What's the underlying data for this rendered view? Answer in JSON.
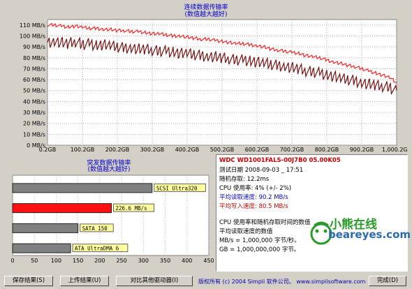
{
  "colors": {
    "read_series": "#7a1010",
    "write_series": "#ff2020",
    "bar_default": "#808080",
    "bar_highlight": "#ff1010",
    "title_blue": "#0000cc",
    "info_red": "#cc0000",
    "label_bg": "#ffffa0"
  },
  "top_chart": {
    "title": "连续数据传输率",
    "subtitle": "(数值越大越好)"
  },
  "burst_chart": {
    "title": "突发数据传输率",
    "subtitle": "(数值越大越好)"
  },
  "chart_data": [
    {
      "type": "line",
      "title": "连续数据传输率",
      "subtitle": "(数值越大越好)",
      "x_ticks": [
        "0.2GB",
        "100.2GB",
        "200.2GB",
        "300.2GB",
        "400.2GB",
        "500.2GB",
        "600.2GB",
        "700.2GB",
        "800.2GB",
        "900.2GB",
        "1,000.2GB"
      ],
      "y_ticks": [
        "0 MB/s",
        "10 MB/s",
        "20 MB/s",
        "30 MB/s",
        "40 MB/s",
        "50 MB/s",
        "60 MB/s",
        "70 MB/s",
        "80 MB/s",
        "90 MB/s",
        "100 MB/s",
        "110 MB/s"
      ],
      "xlim": [
        0.2,
        1000.2
      ],
      "ylim": [
        0,
        115
      ],
      "grid": true,
      "series": [
        {
          "x": [
            0.2,
            20,
            40,
            60,
            80,
            100,
            120,
            140,
            160,
            180,
            200,
            220,
            240,
            260,
            280,
            300,
            320,
            340,
            360,
            380,
            400,
            420,
            440,
            460,
            480,
            500,
            520,
            540,
            560,
            580,
            600,
            620,
            640,
            660,
            680,
            700,
            720,
            740,
            760,
            780,
            800,
            820,
            840,
            860,
            880,
            900,
            920,
            940,
            960,
            980,
            1000.2
          ],
          "y": [
            110,
            110,
            109,
            108,
            109,
            108,
            107,
            107,
            106,
            106,
            105,
            105,
            104,
            104,
            103,
            102,
            102,
            101,
            100,
            100,
            99,
            98,
            97,
            97,
            96,
            95,
            94,
            93,
            93,
            92,
            91,
            90,
            88,
            87,
            86,
            85,
            84,
            82,
            81,
            80,
            78,
            76,
            75,
            73,
            72,
            70,
            68,
            66,
            64,
            62,
            57
          ]
        },
        {
          "x": [
            0.2,
            20,
            40,
            60,
            80,
            100,
            120,
            140,
            160,
            180,
            200,
            220,
            240,
            260,
            280,
            300,
            320,
            340,
            360,
            380,
            400,
            420,
            440,
            460,
            480,
            500,
            520,
            540,
            560,
            580,
            600,
            620,
            640,
            660,
            680,
            700,
            720,
            740,
            760,
            780,
            800,
            820,
            840,
            860,
            880,
            900,
            920,
            940,
            960,
            980,
            1000.2
          ],
          "y": [
            95,
            96,
            95,
            94,
            96,
            93,
            94,
            92,
            93,
            92,
            91,
            90,
            90,
            89,
            89,
            88,
            87,
            87,
            86,
            85,
            85,
            84,
            83,
            82,
            82,
            81,
            80,
            79,
            79,
            78,
            77,
            76,
            75,
            74,
            73,
            72,
            71,
            69,
            68,
            67,
            65,
            64,
            62,
            61,
            60,
            58,
            57,
            56,
            55,
            54,
            50
          ]
        }
      ]
    },
    {
      "type": "bar",
      "title": "突发数据传输率",
      "subtitle": "(数值越大越好)",
      "orientation": "horizontal",
      "categories": [
        "SCSI Ultra320",
        "226.6 MB/s",
        "SATA 150",
        "ATA UltraDMA 6"
      ],
      "values": [
        320,
        226.6,
        150,
        133
      ],
      "x_ticks": [
        "0",
        "50",
        "100",
        "150",
        "200",
        "250",
        "300",
        "350",
        "400",
        "450"
      ],
      "xlim": [
        0,
        450
      ],
      "highlight_index": 1
    }
  ],
  "info": {
    "drive_name": "WDC WD1001FALS-00J7B0 05.00K05",
    "test_date": "测试日期 2008-09-03 _ 17:51",
    "random_access": "随机存取: 12.2ms",
    "cpu_usage": "CPU 使用率: 4% (+/- 2%)",
    "avg_read": "平均读取速度: 90.2 MB/s",
    "avg_write": "平均写入速度: 80.5 MB/s",
    "note_1": "CPU 使用率和随机存取时间的数值",
    "note_2": "平均读取速度的数值",
    "note_3": "MB/s = 1,000,000 字节/秒。",
    "note_4": "GB = 1,000,000,000 字节。",
    "logo_cn": "小熊在线",
    "logo_en": "beareyes.com"
  },
  "buttons": {
    "save": "保存结果(S)",
    "upload": "上传结果(U)",
    "compare": "对比其他驱动器(I)",
    "done": "完成(D)"
  },
  "copyright": "版权所有 (c) 2004 Simpli 软件公司。 www.simplisoftware.com"
}
